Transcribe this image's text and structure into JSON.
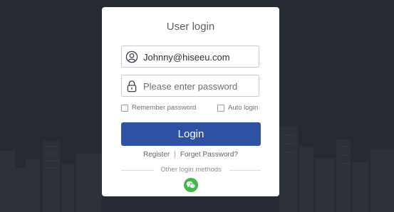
{
  "login_card": {
    "title": "User login",
    "username": {
      "value": "Johnny@hiseeu.com",
      "icon": "user-icon"
    },
    "password": {
      "value": "",
      "placeholder": "Please enter password",
      "icon": "lock-icon"
    },
    "remember_password": {
      "label": "Remember password",
      "checked": false
    },
    "auto_login": {
      "label": "Auto login",
      "checked": false
    },
    "login_button": "Login",
    "register_link": "Register",
    "separator": "|",
    "forget_password_link": "Forget Password?",
    "other_methods_label": "Other login methods",
    "wechat_icon": "wechat-icon"
  },
  "colors": {
    "background": "#262a33",
    "primary": "#2e51a3",
    "wechat": "#42b64a"
  }
}
